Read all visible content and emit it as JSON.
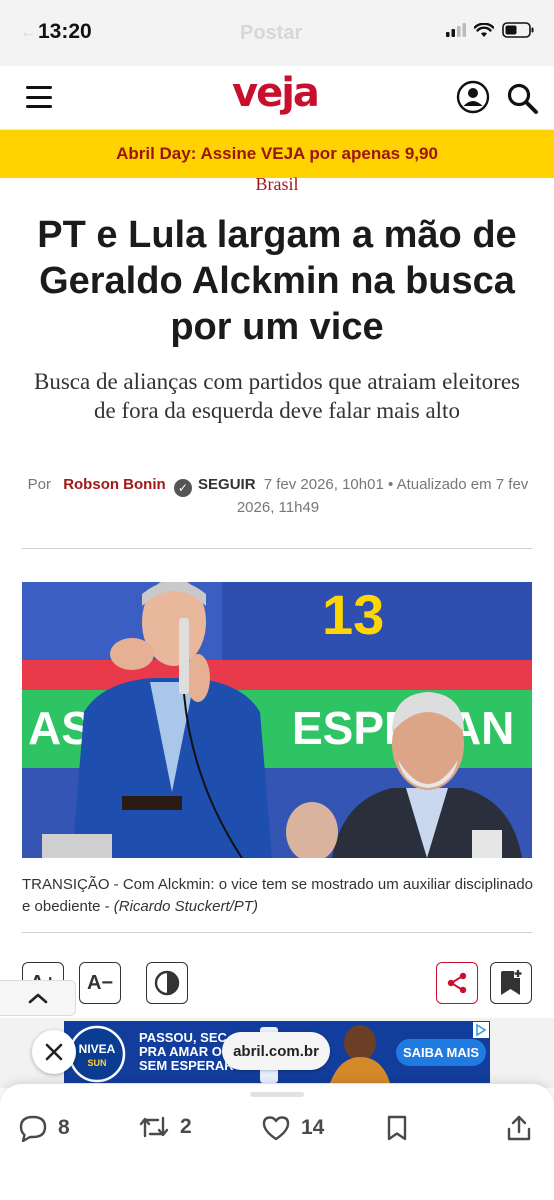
{
  "status_bar": {
    "time": "13:20",
    "title_ghost": "Postar"
  },
  "site": {
    "logo": "veja",
    "brand_color": "#c8102e",
    "icons": [
      "menu-icon",
      "user-icon",
      "search-icon"
    ]
  },
  "promo": {
    "text": "Abril Day: Assine VEJA por apenas 9,90",
    "background": "#ffd200"
  },
  "article": {
    "category": "Brasil",
    "headline": "PT e Lula largam a mão de Geraldo Alckmin na busca por um vice",
    "subheadline": "Busca de alianças com partidos que atraiam eleitores de fora da esquerda deve falar mais alto",
    "byline": {
      "prefix": "Por",
      "author": "Robson Bonin",
      "follow": "SEGUIR",
      "date": "7 fev 2026, 10h01 • Atualizado em 7 fev 2026, 11h49"
    },
    "photo": {
      "background_number": "13",
      "background_word": "ESPERAN",
      "left_fragment": "AS"
    },
    "caption": {
      "tag": "TRANSIÇÃO - ",
      "text": " Com Alckmin: o vice tem se mostrado um auxiliar disciplinado e obediente - ",
      "credit": "(Ricardo Stuckert/PT)"
    }
  },
  "tools": {
    "font_increase": "A+",
    "font_decrease": "A−",
    "icons": [
      "contrast-icon",
      "share-icon",
      "bookmark-add-icon",
      "chevron-up-icon"
    ]
  },
  "ad": {
    "brand": "NIVEA",
    "brand_sub": "SUN",
    "text_lines": [
      "PASSOU, SEC",
      "PRA AMAR O",
      "SEM ESPERAR"
    ],
    "cta": "SAIBA MAIS",
    "domain": "abril.com.br"
  },
  "actions": {
    "replies": "8",
    "reposts": "2",
    "likes": "14"
  }
}
